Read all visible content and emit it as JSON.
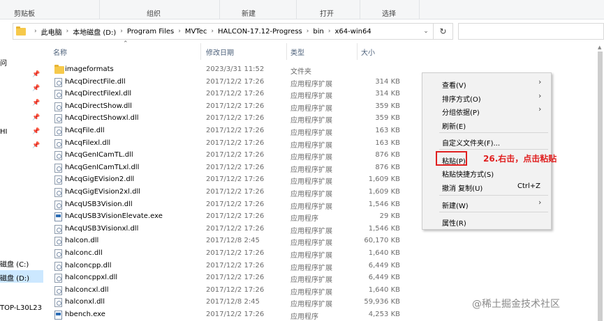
{
  "ribbon": {
    "groups": [
      "剪贴板",
      "组织",
      "新建",
      "打开",
      "选择"
    ]
  },
  "address": {
    "crumbs": [
      "此电脑",
      "本地磁盘 (D:)",
      "Program Files",
      "MVTec",
      "HALCON-17.12-Progress",
      "bin",
      "x64-win64"
    ],
    "dropdown_icon": "chevron-down-icon",
    "refresh_icon": "refresh-icon"
  },
  "nav": {
    "items": [
      "问",
      "HI",
      "磁盘 (C:)",
      "磁盘 (D:)",
      "TOP-L30L23"
    ]
  },
  "columns": {
    "name": "名称",
    "modified": "修改日期",
    "type": "类型",
    "size": "大小"
  },
  "files": [
    {
      "name": "imageformats",
      "date": "2023/3/31 11:52",
      "type": "文件夹",
      "size": "",
      "icon": "folder-icon"
    },
    {
      "name": "hAcqDirectFile.dll",
      "date": "2017/12/2 17:26",
      "type": "应用程序扩展",
      "size": "314 KB",
      "icon": "dll-file-icon"
    },
    {
      "name": "hAcqDirectFilexl.dll",
      "date": "2017/12/2 17:26",
      "type": "应用程序扩展",
      "size": "314 KB",
      "icon": "dll-file-icon"
    },
    {
      "name": "hAcqDirectShow.dll",
      "date": "2017/12/2 17:26",
      "type": "应用程序扩展",
      "size": "359 KB",
      "icon": "dll-file-icon"
    },
    {
      "name": "hAcqDirectShowxl.dll",
      "date": "2017/12/2 17:26",
      "type": "应用程序扩展",
      "size": "359 KB",
      "icon": "dll-file-icon"
    },
    {
      "name": "hAcqFile.dll",
      "date": "2017/12/2 17:26",
      "type": "应用程序扩展",
      "size": "163 KB",
      "icon": "dll-file-icon"
    },
    {
      "name": "hAcqFilexl.dll",
      "date": "2017/12/2 17:26",
      "type": "应用程序扩展",
      "size": "163 KB",
      "icon": "dll-file-icon"
    },
    {
      "name": "hAcqGenICamTL.dll",
      "date": "2017/12/2 17:26",
      "type": "应用程序扩展",
      "size": "876 KB",
      "icon": "dll-file-icon"
    },
    {
      "name": "hAcqGenICamTLxl.dll",
      "date": "2017/12/2 17:26",
      "type": "应用程序扩展",
      "size": "876 KB",
      "icon": "dll-file-icon"
    },
    {
      "name": "hAcqGigEVision2.dll",
      "date": "2017/12/2 17:26",
      "type": "应用程序扩展",
      "size": "1,609 KB",
      "icon": "dll-file-icon"
    },
    {
      "name": "hAcqGigEVision2xl.dll",
      "date": "2017/12/2 17:26",
      "type": "应用程序扩展",
      "size": "1,609 KB",
      "icon": "dll-file-icon"
    },
    {
      "name": "hAcqUSB3Vision.dll",
      "date": "2017/12/2 17:26",
      "type": "应用程序扩展",
      "size": "1,546 KB",
      "icon": "dll-file-icon"
    },
    {
      "name": "hAcqUSB3VisionElevate.exe",
      "date": "2017/12/2 17:26",
      "type": "应用程序",
      "size": "29 KB",
      "icon": "exe-file-icon"
    },
    {
      "name": "hAcqUSB3Visionxl.dll",
      "date": "2017/12/2 17:26",
      "type": "应用程序扩展",
      "size": "1,546 KB",
      "icon": "dll-file-icon"
    },
    {
      "name": "halcon.dll",
      "date": "2017/12/8 2:45",
      "type": "应用程序扩展",
      "size": "60,170 KB",
      "icon": "dll-file-icon"
    },
    {
      "name": "halconc.dll",
      "date": "2017/12/2 17:26",
      "type": "应用程序扩展",
      "size": "1,640 KB",
      "icon": "dll-file-icon"
    },
    {
      "name": "halconcpp.dll",
      "date": "2017/12/2 17:26",
      "type": "应用程序扩展",
      "size": "6,449 KB",
      "icon": "dll-file-icon"
    },
    {
      "name": "halconcppxl.dll",
      "date": "2017/12/2 17:26",
      "type": "应用程序扩展",
      "size": "6,449 KB",
      "icon": "dll-file-icon"
    },
    {
      "name": "halconcxl.dll",
      "date": "2017/12/2 17:26",
      "type": "应用程序扩展",
      "size": "1,640 KB",
      "icon": "dll-file-icon"
    },
    {
      "name": "halconxl.dll",
      "date": "2017/12/8 2:45",
      "type": "应用程序扩展",
      "size": "59,936 KB",
      "icon": "dll-file-icon"
    },
    {
      "name": "hbench.exe",
      "date": "2017/12/2 17:26",
      "type": "应用程序",
      "size": "4,253 KB",
      "icon": "exe-file-icon"
    }
  ],
  "context_menu": {
    "view": "查看(V)",
    "sort": "排序方式(O)",
    "group": "分组依据(P)",
    "refresh": "刷新(E)",
    "customize": "自定义文件夹(F)...",
    "paste": "粘贴(P)",
    "paste_shortcut": "粘贴快捷方式(S)",
    "undo": "撤消 复制(U)",
    "undo_shortcut": "Ctrl+Z",
    "new": "新建(W)",
    "properties": "属性(R)"
  },
  "annotation": "26.右击，点击粘贴",
  "watermark": "@稀土掘金技术社区",
  "colors": {
    "accent_red": "#e02020",
    "selection": "#cce8ff",
    "folder": "#f6c94b"
  }
}
